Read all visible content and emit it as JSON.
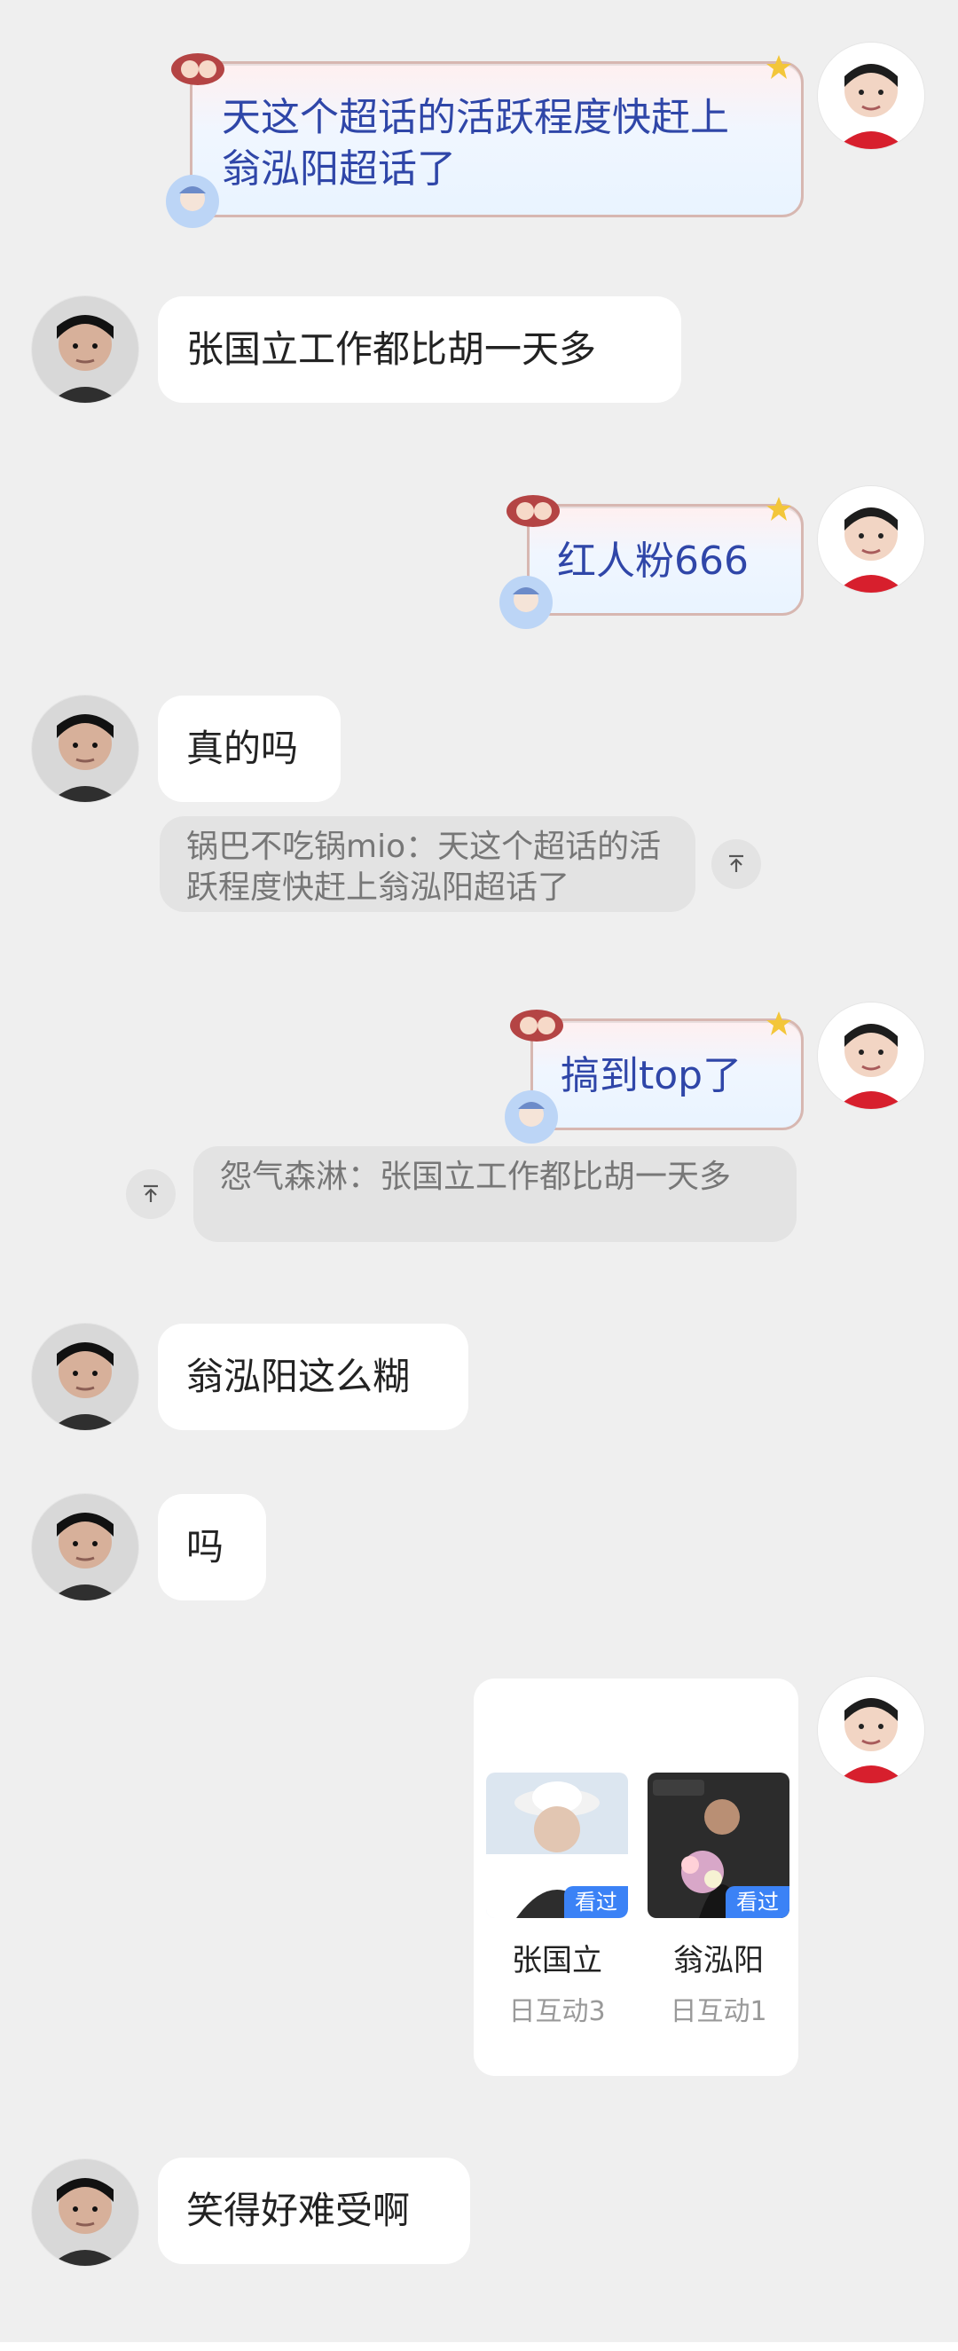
{
  "messages": {
    "m1": "天这个超话的活跃程度快赶上翁泓阳超话了",
    "m2": "张国立工作都比胡一天多",
    "m3": "红人粉666",
    "m4": "真的吗",
    "m4_quote": "锅巴不吃锅mio：天这个超话的活跃程度快赶上翁泓阳超话了",
    "m5": "搞到top了",
    "m5_quote": "怨气森淋：张国立工作都比胡一天多",
    "m6": "翁泓阳这么糊",
    "m7": "吗",
    "m8": "笑得好难受啊"
  },
  "card": {
    "person1": {
      "name": "张国立",
      "meta": "日互动3",
      "badge": "看过"
    },
    "person2": {
      "name": "翁泓阳",
      "meta": "日互动1",
      "badge": "看过"
    }
  },
  "icons": {
    "quote_jump": "up-arrow-icon",
    "star": "star-icon"
  },
  "colors": {
    "accent_blue": "#3b82f6",
    "vip_text": "#2f46a8",
    "background": "#efefef"
  }
}
